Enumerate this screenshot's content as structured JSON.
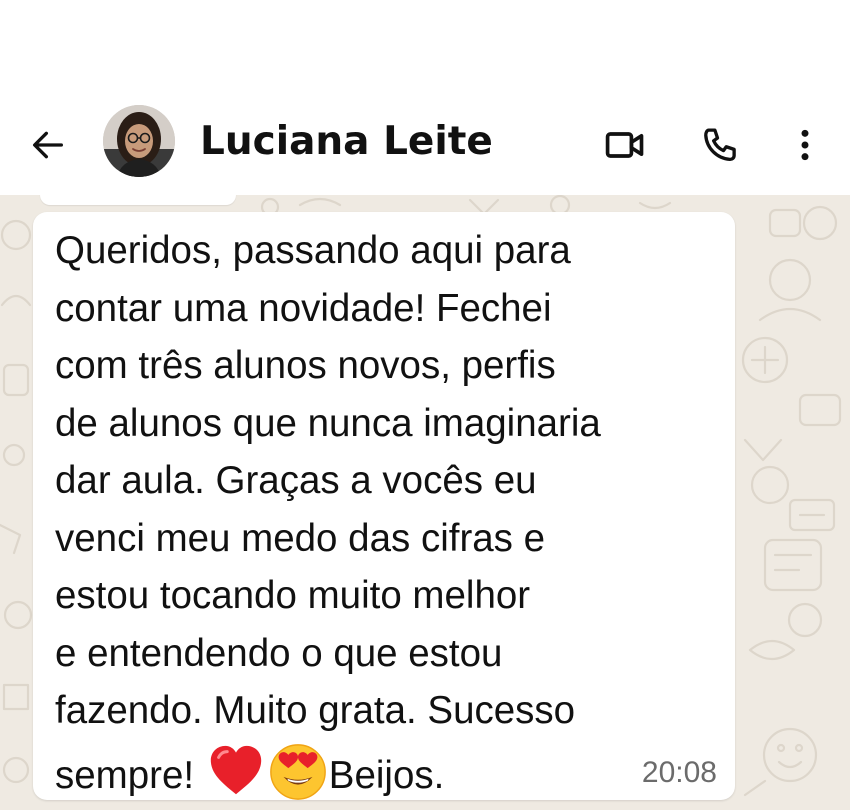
{
  "header": {
    "contact_name": "Luciana Leite",
    "back_icon": "arrow-left-icon",
    "video_icon": "video-camera-icon",
    "call_icon": "phone-icon",
    "menu_icon": "more-vertical-icon"
  },
  "message": {
    "lines": [
      "Queridos, passando aqui para",
      "contar uma novidade! Fechei",
      "com três alunos novos, perfis",
      "de alunos que nunca imaginaria",
      "dar aula. Graças a vocês eu",
      "venci meu medo das cifras e",
      "estou tocando muito melhor",
      "e entendendo o que estou",
      "fazendo. Muito grata. Sucesso"
    ],
    "last_line_start": "sempre! ",
    "last_line_end": "Beijos.",
    "emojis": [
      "red-heart-emoji",
      "heart-eyes-emoji"
    ],
    "time": "20:08"
  },
  "colors": {
    "header_bg": "#ffffff",
    "chat_bg": "#efeae2",
    "bubble_bg": "#ffffff",
    "text": "#111111",
    "timestamp": "#6b6b6b"
  }
}
